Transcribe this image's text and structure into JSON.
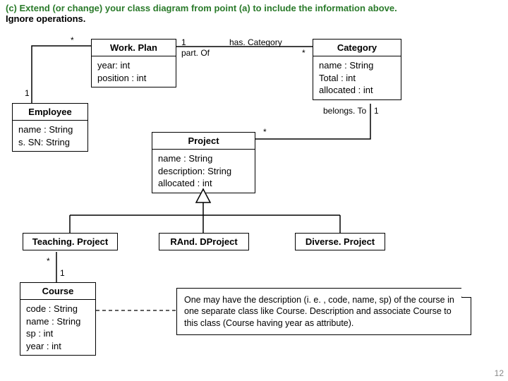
{
  "title_part1": "(c) Extend (or change) your class diagram from point (a) to include the information above. ",
  "title_part2": "Ignore operations.",
  "classes": {
    "workplan": {
      "name": "Work. Plan",
      "attrs": "year: int\nposition : int"
    },
    "employee": {
      "name": "Employee",
      "attrs": "name : String\ns. SN: String"
    },
    "category": {
      "name": "Category",
      "attrs": "name : String\nTotal : int\nallocated : int"
    },
    "project": {
      "name": "Project",
      "attrs": "name : String\ndescription: String\nallocated : int"
    },
    "teaching": {
      "name": "Teaching. Project"
    },
    "randd": {
      "name": "RAnd. DProject"
    },
    "diverse": {
      "name": "Diverse. Project"
    },
    "course": {
      "name": "Course",
      "attrs": "code : String\nname : String\nsp : int\nyear : int"
    }
  },
  "assoc": {
    "partof_role": "part. Of",
    "partof_m1": "1",
    "hascat_role": "has. Category",
    "hascat_m1": "*",
    "belongs_role": "belongs. To",
    "belongs_m1": "1",
    "proj_m1": "*",
    "emp_mstar": "*",
    "emp_m1": "1",
    "course_mstar": "*",
    "course_m1": "1"
  },
  "note": "One may have the description  (i. e. , code, name, sp) of the course in one separate class like Course. Description and associate Course to this class (Course having year as attribute).",
  "slidenum": "12"
}
